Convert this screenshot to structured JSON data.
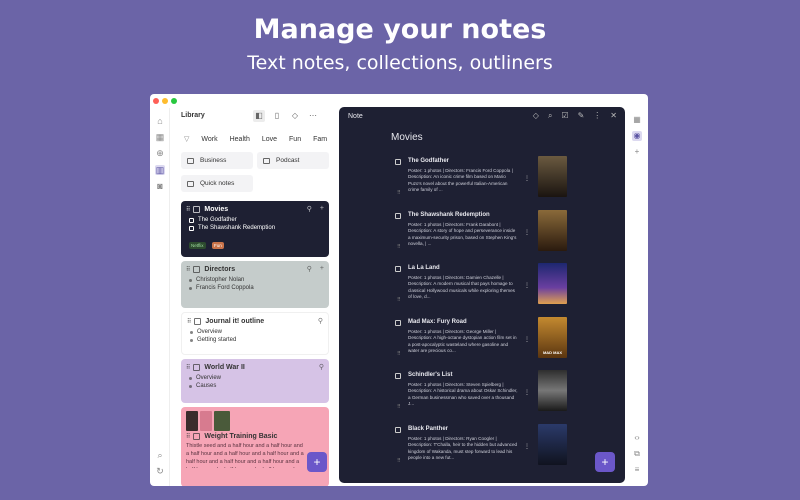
{
  "hero": {
    "title": "Manage your notes",
    "subtitle": "Text notes, collections, outliners"
  },
  "window": {
    "traffic_colors": [
      "#fe5f57",
      "#febc2e",
      "#28c840"
    ]
  },
  "rail": {
    "icons": [
      "home-icon",
      "calendar-icon",
      "target-icon",
      "library-icon",
      "archive-icon"
    ],
    "bottom_icons": [
      "search-icon",
      "sync-icon"
    ]
  },
  "library": {
    "title": "Library",
    "tags": [
      "Work",
      "Health",
      "Love",
      "Fun",
      "Fam"
    ],
    "folders": [
      "Business",
      "Podcast",
      "Quick notes"
    ],
    "cards": {
      "movies": {
        "title": "Movies",
        "items": [
          "The Godfather",
          "The Shawshank Redemption"
        ],
        "chips": [
          "Netflix",
          "Fun"
        ],
        "color": "#1e2033"
      },
      "directors": {
        "title": "Directors",
        "items": [
          "Christopher Nolan",
          "Francis Ford Coppola"
        ],
        "color": "#c5cccb"
      },
      "journal": {
        "title": "Journal it! outline",
        "items": [
          "Overview",
          "Getting started"
        ],
        "color": "#ffffff"
      },
      "worldwar": {
        "title": "World War II",
        "items": [
          "Overview",
          "Causes"
        ],
        "color": "#d6c3e6"
      },
      "weight": {
        "title": "Weight Training Basic",
        "text": "Thistle seed and a half hour and a half hour and a half hour and a half hour and a half hour and a half hour and a half hour and a half hour and a half hour and a half hour and a half hour and...",
        "color": "#f6a5b6"
      }
    },
    "fab_label": "+"
  },
  "note": {
    "header": "Note",
    "heading": "Movies",
    "movies": [
      {
        "title": "The Godfather",
        "desc": "Poster: 1 photos | Directors: Francis Ford Coppola | Description: An iconic crime film based on Mario Puzo's novel about the powerful Italian-American crime family of ...",
        "poster_label": "",
        "poster_color": "#2b211a"
      },
      {
        "title": "The Shawshank Redemption",
        "desc": "Poster: 1 photos | Directors: Frank Darabont | Description: A story of hope and perseverance inside a maximum-security prison, based on Stephen King's novella, | ...",
        "poster_label": "",
        "poster_color": "#5a3e22"
      },
      {
        "title": "La La Land",
        "desc": "Poster: 1 photos | Directors: Damien Chazelle | Description: A modern musical that pays homage to classical Hollywood musicals while exploring themes of love, d...",
        "poster_label": "",
        "poster_color": "#27317a"
      },
      {
        "title": "Mad Max: Fury Road",
        "desc": "Poster: 1 photos | Directors: George Miller | Description: A high-octane dystopian action film set in a post-apocalyptic wasteland where gasoline and water are precious co...",
        "poster_label": "MAD MAX",
        "poster_color": "#9a6320"
      },
      {
        "title": "Schindler's List",
        "desc": "Poster: 1 photos | Directors: Steven Spielberg | Description: A historical drama about Oskar Schindler, a German businessman who saved over a thousand J...",
        "poster_label": "",
        "poster_color": "#3c3c3c"
      },
      {
        "title": "Black Panther",
        "desc": "Poster: 1 photos | Directors: Ryan Coogler | Description: T'Challa, heir to the hidden but advanced kingdom of Wakanda, must step forward to lead his people into a new fut...",
        "poster_label": "",
        "poster_color": "#232a45"
      }
    ],
    "fab_label": "+"
  },
  "colors": {
    "accent": "#6b57c9",
    "background": "#6b64a7"
  }
}
